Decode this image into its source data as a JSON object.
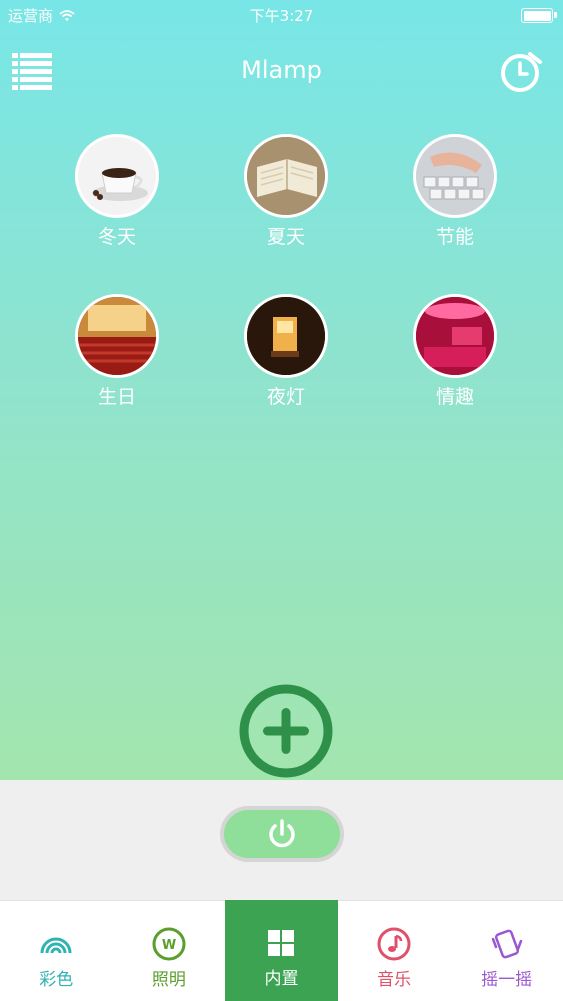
{
  "status_bar": {
    "carrier": "运营商",
    "time": "下午3:27"
  },
  "header": {
    "title": "Mlamp"
  },
  "scenes": [
    {
      "label": "冬天",
      "icon": "coffee-cup-image"
    },
    {
      "label": "夏天",
      "icon": "open-book-image"
    },
    {
      "label": "节能",
      "icon": "keyboard-image"
    },
    {
      "label": "生日",
      "icon": "theater-image"
    },
    {
      "label": "夜灯",
      "icon": "lamp-image"
    },
    {
      "label": "情趣",
      "icon": "pink-room-image"
    }
  ],
  "tabs": [
    {
      "label": "彩色",
      "icon": "rainbow-icon",
      "color": "#2fb3b3"
    },
    {
      "label": "照明",
      "icon": "w-circle-icon",
      "color": "#5a9e2c"
    },
    {
      "label": "内置",
      "icon": "grid-icon",
      "color": "#ffffff",
      "active": true
    },
    {
      "label": "音乐",
      "icon": "music-note-icon",
      "color": "#e0506a"
    },
    {
      "label": "摇一摇",
      "icon": "phone-shake-icon",
      "color": "#9b59d0"
    }
  ],
  "colors": {
    "accent_green": "#3a9a4e",
    "active_tab": "#3ca352"
  }
}
